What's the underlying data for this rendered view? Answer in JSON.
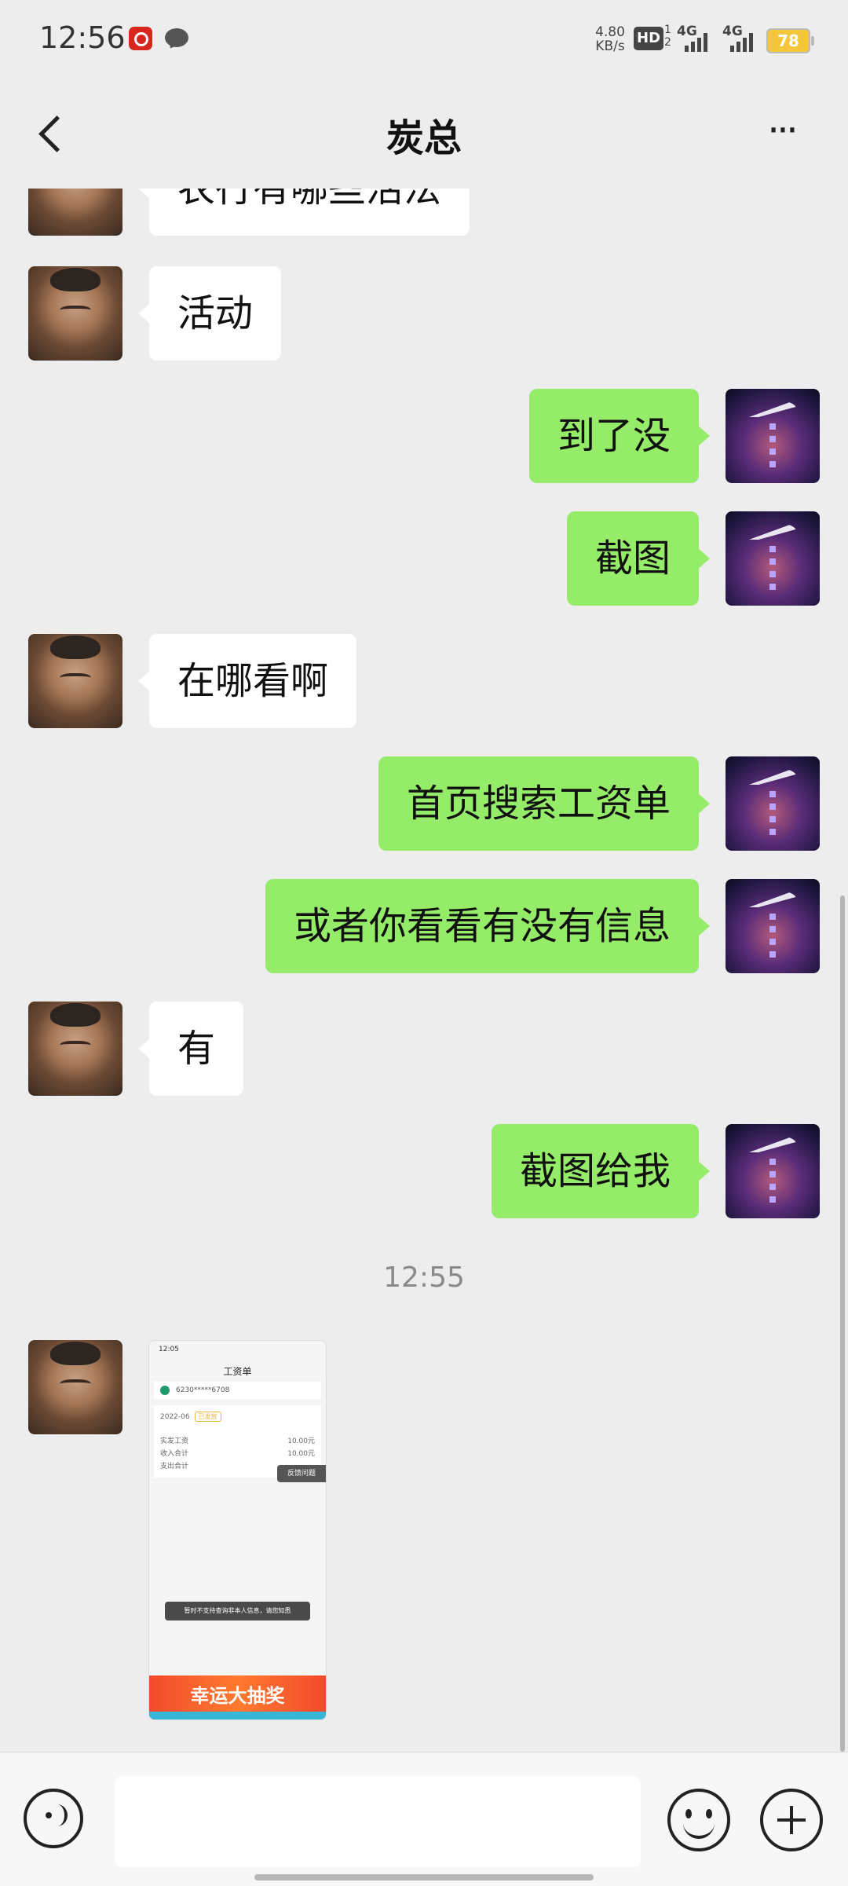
{
  "status_bar": {
    "time": "12:56",
    "net_speed_value": "4.80",
    "net_speed_unit": "KB/s",
    "hd_label": "HD",
    "hd_sub": "1 2",
    "signal1_label": "4G",
    "signal2_label": "4G",
    "battery": "78",
    "icons": [
      "netease-music-icon",
      "message-icon"
    ]
  },
  "nav": {
    "title": "炭总",
    "back_icon": "chevron-left-icon",
    "more_label": "···"
  },
  "messages": [
    {
      "side": "left",
      "text": "农行有哪些活法"
    },
    {
      "side": "left",
      "text": "活动"
    },
    {
      "side": "right",
      "text": "到了没"
    },
    {
      "side": "right",
      "text": "截图"
    },
    {
      "side": "left",
      "text": "在哪看啊"
    },
    {
      "side": "right",
      "text": "首页搜索工资单"
    },
    {
      "side": "right",
      "text": "或者你看看有没有信息"
    },
    {
      "side": "left",
      "text": "有"
    },
    {
      "side": "right",
      "text": "截图给我"
    }
  ],
  "timestamp": "12:55",
  "image_message": {
    "status_time": "12:05",
    "title": "工资单",
    "account": "6230*****6708",
    "period": "2022-06",
    "tag": "已发放",
    "rows": [
      {
        "label": "实发工资",
        "value": "10.00元"
      },
      {
        "label": "收入合计",
        "value": "10.00元"
      },
      {
        "label": "支出合计",
        "value": ""
      }
    ],
    "float_button": "反馈问题",
    "toast": "暂时不支持查询非本人信息，请您知悉",
    "banner": "幸运大抽奖"
  },
  "input_bar": {
    "placeholder": "",
    "icons": [
      "voice-icon",
      "emoji-icon",
      "plus-icon"
    ]
  }
}
